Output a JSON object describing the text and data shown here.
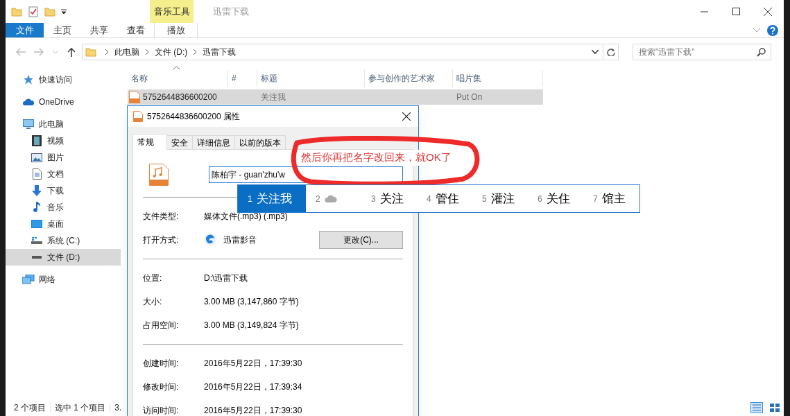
{
  "window": {
    "title": "迅雷下载",
    "context_group": "音乐工具"
  },
  "ribbon_tabs": [
    {
      "label": "文件",
      "kind": "file"
    },
    {
      "label": "主页",
      "kind": "normal"
    },
    {
      "label": "共享",
      "kind": "normal"
    },
    {
      "label": "查看",
      "kind": "normal"
    },
    {
      "label": "播放",
      "kind": "contextual"
    }
  ],
  "address": {
    "breadcrumbs": [
      "此电脑",
      "文件 (D:)",
      "迅雷下载"
    ],
    "search_placeholder": "搜索\"迅雷下载\""
  },
  "sidebar": {
    "items": [
      {
        "label": "快速访问",
        "kind": "star",
        "selected": false
      },
      {
        "label": "OneDrive",
        "kind": "cloud",
        "selected": false
      },
      {
        "label": "此电脑",
        "kind": "pc",
        "selected": false,
        "children": [
          {
            "label": "视频",
            "kind": "video",
            "selected": false
          },
          {
            "label": "图片",
            "kind": "picture",
            "selected": false
          },
          {
            "label": "文档",
            "kind": "doc",
            "selected": false
          },
          {
            "label": "下载",
            "kind": "download",
            "selected": false
          },
          {
            "label": "音乐",
            "kind": "music",
            "selected": false
          },
          {
            "label": "桌面",
            "kind": "desktop",
            "selected": false
          },
          {
            "label": "系统 (C:)",
            "kind": "sysdrive",
            "selected": false
          },
          {
            "label": "文件 (D:)",
            "kind": "drive",
            "selected": true
          }
        ]
      },
      {
        "label": "网络",
        "kind": "network",
        "selected": false
      }
    ]
  },
  "table": {
    "columns": [
      "名称",
      "#",
      "标题",
      "参与创作的艺术家",
      "唱片集"
    ],
    "rows": [
      {
        "name": "5752644836600200",
        "title": "关注我",
        "album": "Put On",
        "selected": true
      }
    ]
  },
  "status_bar": [
    "2 个项目",
    "选中 1 个项目",
    "3."
  ],
  "dialog": {
    "title": "5752644836600200 属性",
    "tabs": [
      {
        "label": "常规",
        "selected": true
      },
      {
        "label": "安全",
        "selected": false
      },
      {
        "label": "详细信息",
        "selected": false
      },
      {
        "label": "以前的版本",
        "selected": false
      }
    ],
    "filename": "陈柏宇 - guan'zhu'w",
    "groups": [
      [
        {
          "label": "文件类型:",
          "value": "媒体文件(.mp3) (.mp3)"
        },
        {
          "label": "打开方式:",
          "value": "迅雷影音",
          "button": "更改(C)..."
        }
      ],
      [
        {
          "label": "位置:",
          "value": "D:\\迅雷下载"
        },
        {
          "label": "大小:",
          "value": "3.00 MB (3,147,860 字节)"
        },
        {
          "label": "占用空间:",
          "value": "3.00 MB (3,149,824 字节)"
        }
      ],
      [
        {
          "label": "创建时间:",
          "value": "2016年5月22日，17:39:30"
        },
        {
          "label": "修改时间:",
          "value": "2016年5月22日，17:39:34"
        },
        {
          "label": "访问时间:",
          "value": "2016年5月22日，17:39:30"
        }
      ]
    ]
  },
  "ime_candidates": [
    {
      "index": "1",
      "kind": "text",
      "text": "关注我",
      "selected": true
    },
    {
      "index": "2",
      "kind": "cloud",
      "selected": false
    },
    {
      "index": "3",
      "kind": "text",
      "text": "关注",
      "selected": false
    },
    {
      "index": "4",
      "kind": "text",
      "text": "管住",
      "selected": false
    },
    {
      "index": "5",
      "kind": "text",
      "text": "灌注",
      "selected": false
    },
    {
      "index": "6",
      "kind": "text",
      "text": "关住",
      "selected": false
    },
    {
      "index": "7",
      "kind": "text",
      "text": "馆主",
      "selected": false
    }
  ],
  "annotation": {
    "text": "然后你再把名字改回来，就OK了"
  }
}
